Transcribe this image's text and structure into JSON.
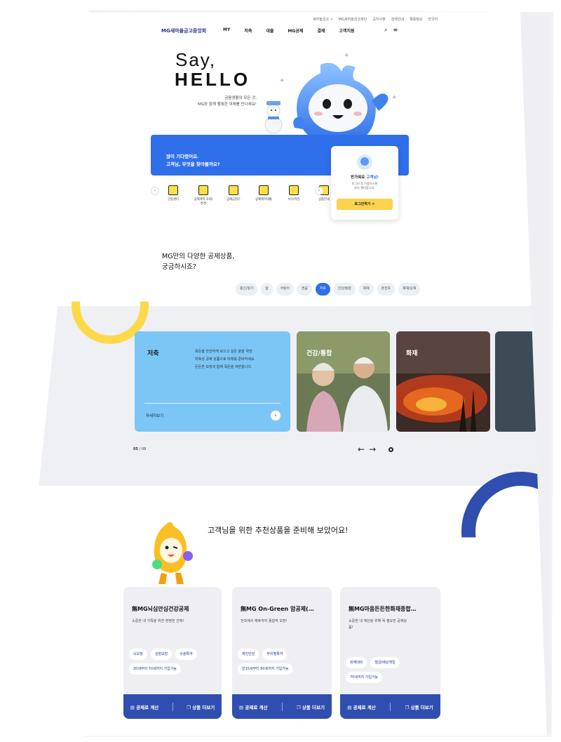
{
  "header": {
    "util": [
      "새마을금고 ↗",
      "MG새마을금고재단",
      "공지사항",
      "검색안내",
      "채용정보",
      "한국어"
    ],
    "logo": "MG새마을금고중앙회",
    "gnb": [
      "MY",
      "저축",
      "대출",
      "MG공제",
      "결제",
      "고객지원"
    ],
    "search_icon": "search-icon",
    "menu_icon": "menu-icon"
  },
  "hero": {
    "say": "Say,",
    "hello": "HELLO",
    "sub": [
      "금융생활의 모든 것,",
      "MG와 함께 행복한 미래를 만나세요!"
    ],
    "banner": [
      "많이 기다렸어요.",
      "고객님, 무엇을 찾아볼까요?"
    ]
  },
  "quick_menu": [
    {
      "icon": "certificate-icon",
      "label": "인증센터"
    },
    {
      "icon": "receipt-icon",
      "label": "공제계약 조회/변경"
    },
    {
      "icon": "pen-icon",
      "label": "공제금청구"
    },
    {
      "icon": "clipboard-icon",
      "label": "공제계약대출"
    },
    {
      "icon": "document-icon",
      "label": "서식/약관"
    },
    {
      "icon": "book-icon",
      "label": "상품안내"
    },
    {
      "icon": "monitor-icon",
      "label": "휴면공제금 조회"
    }
  ],
  "login_card": {
    "greeting_prefix": "반가워요",
    "greeting_name": "고객님!",
    "desc": [
      "로그인 후 이용하시면",
      "보다 편리합니다."
    ],
    "button": "로그인하기 >"
  },
  "products": {
    "title": [
      "MG만의 다양한 공제상품,",
      "궁금하시죠?"
    ],
    "chips": [
      "종신/정기",
      "암",
      "어린이",
      "연금",
      "저축",
      "건강/통합",
      "화재",
      "운전자",
      "재해/상해"
    ],
    "active_chip": "저축",
    "cards": [
      {
        "title": "저축",
        "desc": [
          "목돈을 안전하게 모으고 싶은 분을 위한",
          "저축성 공제 상품으로 미래를 준비하세요.",
          "든든한 보장과 함께 목돈을 마련합니다."
        ],
        "more": "자세히보기"
      },
      {
        "title": "건강/통합"
      },
      {
        "title": "화재"
      }
    ],
    "pager_current": "05",
    "pager_total": "09"
  },
  "recommend": {
    "title": "고객님을 위한 추천상품을 준비해 보았어요!",
    "cards": [
      {
        "name": "無MG뇌심안심건강공제",
        "desc": [
          "소중한 내 가족을 위한 현명한 선택!"
        ],
        "tags": [
          "뇌보장",
          "심장보장",
          "수술특약",
          "20세부터 70세까지 가입가능"
        ]
      },
      {
        "name": "無MG On-Green 암공제(…",
        "desc": [
          "전조에서 예후까지 종합적 보장!"
        ],
        "tags": [
          "재진단암",
          "부위별특약",
          "만15세부터 80세까지 가입가능"
        ]
      },
      {
        "name": "無MG마음든든한화재종합…",
        "desc": [
          "소중한 내 재산을 위해 꼭 필요한 공제상",
          "품!"
        ],
        "tags": [
          "화재대비",
          "벌금/배상책임",
          "70세까지 가입가능"
        ]
      }
    ],
    "calc_label": "공제료 계산",
    "detail_label": "상품 더보기"
  },
  "colors": {
    "primary": "#2f6fea",
    "navy": "#2f4eb0",
    "yellow": "#fcd94b",
    "sky": "#7cc6f6"
  }
}
